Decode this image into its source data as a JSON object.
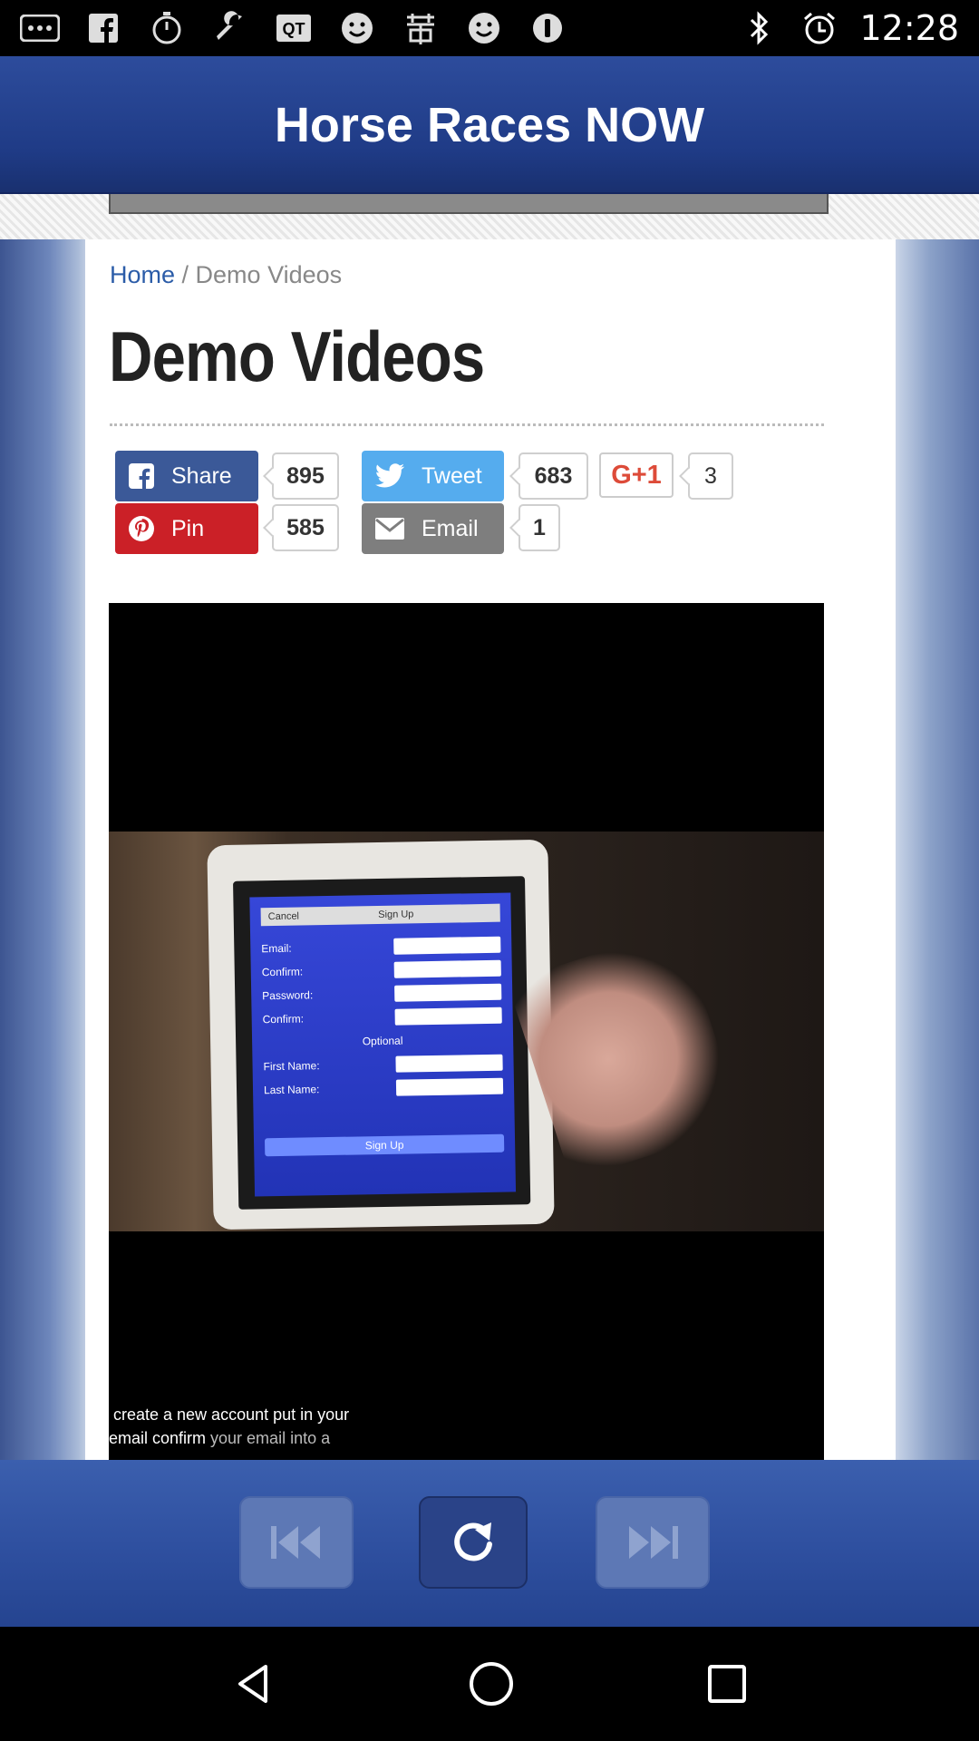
{
  "status_bar": {
    "time": "12:28",
    "icons": [
      "more-icon",
      "facebook-icon",
      "stopwatch-icon",
      "wrench-icon",
      "qr-icon",
      "smiley-icon",
      "kanji-icon",
      "smiley-icon",
      "info-circle-icon"
    ],
    "right_icons": [
      "bluetooth-icon",
      "alarm-icon"
    ]
  },
  "app": {
    "title": "Horse Races NOW"
  },
  "page": {
    "breadcrumb_home": "Home",
    "breadcrumb_sep": " / ",
    "breadcrumb_current": "Demo Videos",
    "heading": "Demo Videos"
  },
  "social": {
    "share_label": "Share",
    "share_count": "895",
    "tweet_label": "Tweet",
    "tweet_count": "683",
    "gplus_label": "G+1",
    "gplus_count": "3",
    "pin_label": "Pin",
    "pin_count": "585",
    "email_label": "Email",
    "email_count": "1",
    "colors": {
      "facebook": "#3b5998",
      "twitter": "#55acee",
      "pinterest": "#cb2027",
      "email": "#7e7e7e",
      "gplus": "#dd4b39"
    }
  },
  "video": {
    "tablet": {
      "cancel": "Cancel",
      "title": "Sign Up",
      "fields": [
        "Email:",
        "Confirm:",
        "Password:",
        "Confirm:"
      ],
      "optional": "Optional",
      "fields2": [
        "First Name:",
        "Last Name:"
      ],
      "button": "Sign Up"
    },
    "caption_line1": "create a new account put in your",
    "caption_line2_bold": "email confirm",
    "caption_line2_rest": " your email into a"
  },
  "controls": {
    "prev_icon": "rewind-icon",
    "refresh_icon": "refresh-icon",
    "next_icon": "skip-forward-icon"
  },
  "navbar": {
    "icons": [
      "back-icon",
      "home-icon",
      "recents-icon"
    ]
  }
}
